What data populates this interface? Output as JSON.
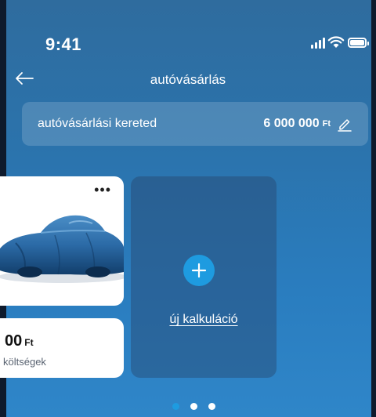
{
  "status_bar": {
    "time": "9:41",
    "icons": [
      "signal-icon",
      "wifi-icon",
      "battery-icon"
    ]
  },
  "nav": {
    "back_icon": "arrow-left-icon",
    "title": "autóvásárlás"
  },
  "budget": {
    "label": "autóvásárlási kereted",
    "amount": "6 000 000",
    "currency": "Ft",
    "edit_icon": "pencil-icon"
  },
  "car_card": {
    "more_icon": "more-horizontal-icon",
    "image": "covered-car-image"
  },
  "cost_card": {
    "amount": "00",
    "currency": "Ft",
    "label": "költségek"
  },
  "new_card": {
    "plus_icon": "plus-icon",
    "label": "új kalkuláció"
  },
  "pagination": {
    "count": 3,
    "active_index": 0
  },
  "colors": {
    "accent": "#1e9be0",
    "background_top": "#2f6c9e",
    "background_bottom": "#2f86c9",
    "card": "#ffffff"
  }
}
